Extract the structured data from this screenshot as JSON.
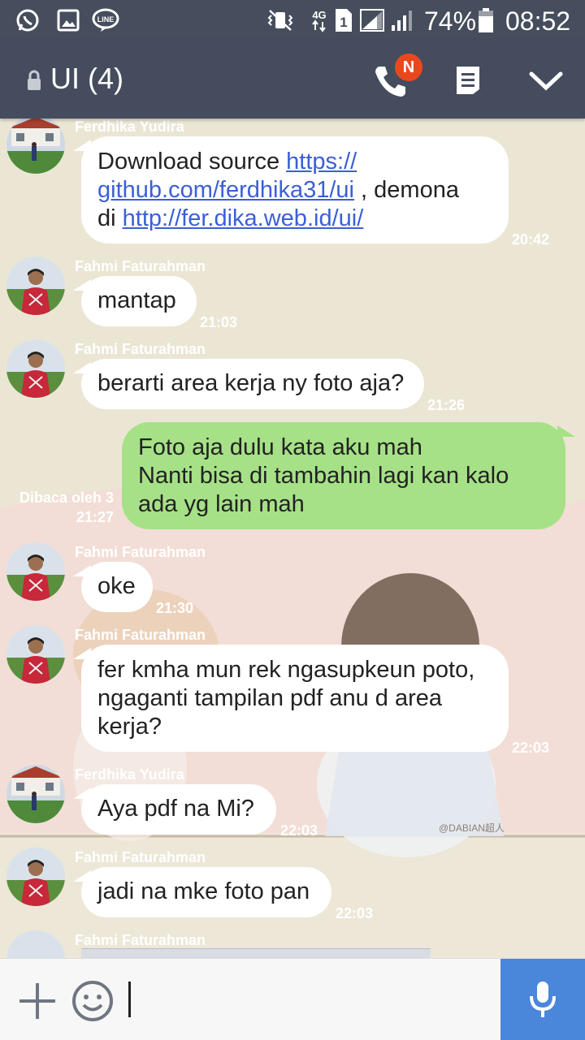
{
  "status_bar": {
    "battery": "74%",
    "time": "08:52",
    "network": "4G",
    "sim": "1",
    "left_icons": [
      "whatsapp-icon",
      "gallery-icon",
      "line-icon"
    ],
    "right_icons": [
      "vibrate-icon",
      "network-4g-icon",
      "sim-icon",
      "signal-icon",
      "signal-icon",
      "battery-icon"
    ]
  },
  "header": {
    "title": "UI (4)",
    "call_badge": "N",
    "icons": [
      "lock-icon",
      "phone-icon",
      "notes-icon",
      "chevron-down-icon"
    ]
  },
  "messages": [
    {
      "sender": "Ferdhika Yudira",
      "lines": [
        [
          "Download source ",
          "https://"
        ],
        [
          "github.com/ferdhika31/ui",
          " , demona"
        ],
        [
          "di ",
          "http://fer.dika.web.id/ui/"
        ]
      ],
      "time": "20:42"
    },
    {
      "sender": "Fahmi Faturahman",
      "text": "mantap",
      "time": "21:03"
    },
    {
      "sender": "Fahmi Faturahman",
      "text": "berarti area kerja ny foto aja?",
      "time": "21:26"
    },
    {
      "mine": true,
      "lines": [
        "Foto aja dulu kata aku mah",
        "Nanti bisa di tambahin lagi kan kalo",
        "ada yg lain mah"
      ],
      "read": "Dibaca oleh 3",
      "time": "21:27"
    },
    {
      "sender": "Fahmi Faturahman",
      "text": "oke",
      "time": "21:30"
    },
    {
      "sender": "Fahmi Faturahman",
      "lines": [
        "fer kmha mun rek ngasupkeun poto,",
        "ngaganti tampilan pdf anu d area",
        "kerja?"
      ],
      "time": "22:03"
    },
    {
      "sender": "Ferdhika Yudira",
      "text": "Aya pdf na Mi?",
      "time": "22:03"
    },
    {
      "sender": "Fahmi Faturahman",
      "text": "jadi na mke foto pan",
      "time": "22:03"
    },
    {
      "sender": "Fahmi Faturahman"
    }
  ],
  "input": {
    "icons": [
      "plus-icon",
      "emoji-icon",
      "microphone-icon"
    ],
    "value": ""
  },
  "colors": {
    "header_bg": "#454c5d",
    "my_bubble": "#a6e187",
    "their_bubble": "#ffffff",
    "mic_button": "#4a86d9",
    "link": "#3b5fd8"
  }
}
